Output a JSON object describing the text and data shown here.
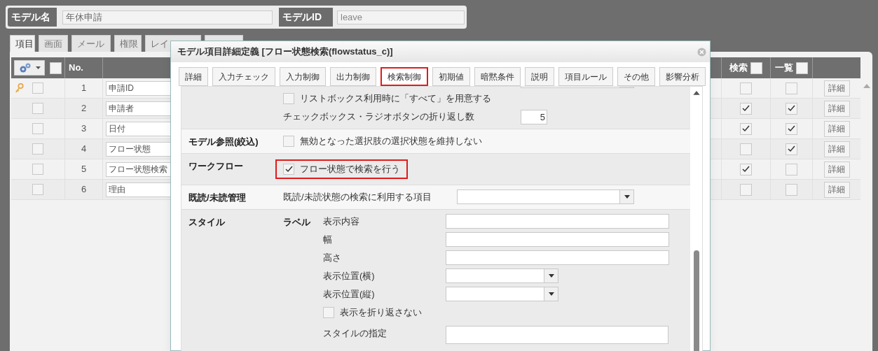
{
  "model_bar": {
    "name_label": "モデル名",
    "name_value": "年休申請",
    "id_label": "モデルID",
    "id_value": "leave"
  },
  "tabs": [
    {
      "label": "項目",
      "selected": true
    },
    {
      "label": "画面",
      "selected": false
    },
    {
      "label": "メール",
      "selected": false
    },
    {
      "label": "権限",
      "selected": false
    },
    {
      "label": "レイ",
      "selected": false
    },
    {
      "selected": false
    }
  ],
  "table": {
    "columns": {
      "no": "No.",
      "search": "検索",
      "list": "一覧"
    },
    "select_all": false,
    "search_all": false,
    "list_all": false,
    "rows": [
      {
        "key": true,
        "selected": false,
        "no": "1",
        "name": "申請ID",
        "search": false,
        "list": false,
        "button": "詳細"
      },
      {
        "key": false,
        "selected": false,
        "no": "2",
        "name": "申請者",
        "search": true,
        "list": true,
        "button": "詳細"
      },
      {
        "key": false,
        "selected": false,
        "no": "3",
        "name": "日付",
        "search": true,
        "list": true,
        "button": "詳細"
      },
      {
        "key": false,
        "selected": false,
        "no": "4",
        "name": "フロー状態",
        "search": false,
        "list": true,
        "button": "詳細"
      },
      {
        "key": false,
        "selected": false,
        "no": "5",
        "name": "フロー状態検索",
        "search": true,
        "list": false,
        "button": "詳細"
      },
      {
        "key": false,
        "selected": false,
        "no": "6",
        "name": "理由",
        "search": false,
        "list": false,
        "button": "詳細"
      }
    ]
  },
  "dialog": {
    "title": "モデル項目詳細定義 [フロー状態検索(flowstatus_c)]",
    "tabs": [
      {
        "label": "詳細",
        "selected": false
      },
      {
        "label": "入力チェック",
        "selected": false
      },
      {
        "label": "入力制御",
        "selected": false
      },
      {
        "label": "出力制御",
        "selected": false
      },
      {
        "label": "検索制御",
        "selected": true
      },
      {
        "label": "初期値",
        "selected": false
      },
      {
        "label": "暗黙条件",
        "selected": false
      },
      {
        "label": "説明",
        "selected": false
      },
      {
        "label": "項目ルール",
        "selected": false
      },
      {
        "label": "その他",
        "selected": false
      },
      {
        "label": "影響分析",
        "selected": false
      }
    ],
    "sections": [
      {
        "items": [
          {
            "kind": "cutselect"
          },
          {
            "kind": "checkbox",
            "label": "リストボックス利用時に「すべて」を用意する",
            "checked": false,
            "highlighted": false
          },
          {
            "kind": "number",
            "label": "チェックボックス・ラジオボタンの折り返し数",
            "value": "5"
          }
        ]
      },
      {
        "heading": "モデル参照(絞込)",
        "items": [
          {
            "kind": "checkbox",
            "label": "無効となった選択肢の選択状態を維持しない",
            "checked": false,
            "highlighted": false
          }
        ]
      },
      {
        "heading": "ワークフロー",
        "items": [
          {
            "kind": "checkbox",
            "label": "フロー状態で検索を行う",
            "checked": true,
            "highlighted": true
          }
        ]
      },
      {
        "heading": "既読/未読管理",
        "items": [
          {
            "kind": "wideselect",
            "label": "既読/未読状態の検索に利用する項目"
          }
        ]
      },
      {
        "heading": "スタイル",
        "subheading": "ラベル",
        "items": [
          {
            "kind": "text",
            "label": "表示内容"
          },
          {
            "kind": "text",
            "label": "幅"
          },
          {
            "kind": "text",
            "label": "高さ"
          },
          {
            "kind": "select",
            "label": "表示位置(横)"
          },
          {
            "kind": "select",
            "label": "表示位置(縦)"
          },
          {
            "kind": "checkbox",
            "label": "表示を折り返さない",
            "checked": false,
            "highlighted": false
          },
          {
            "kind": "tall",
            "label": "スタイルの指定"
          }
        ]
      }
    ]
  }
}
